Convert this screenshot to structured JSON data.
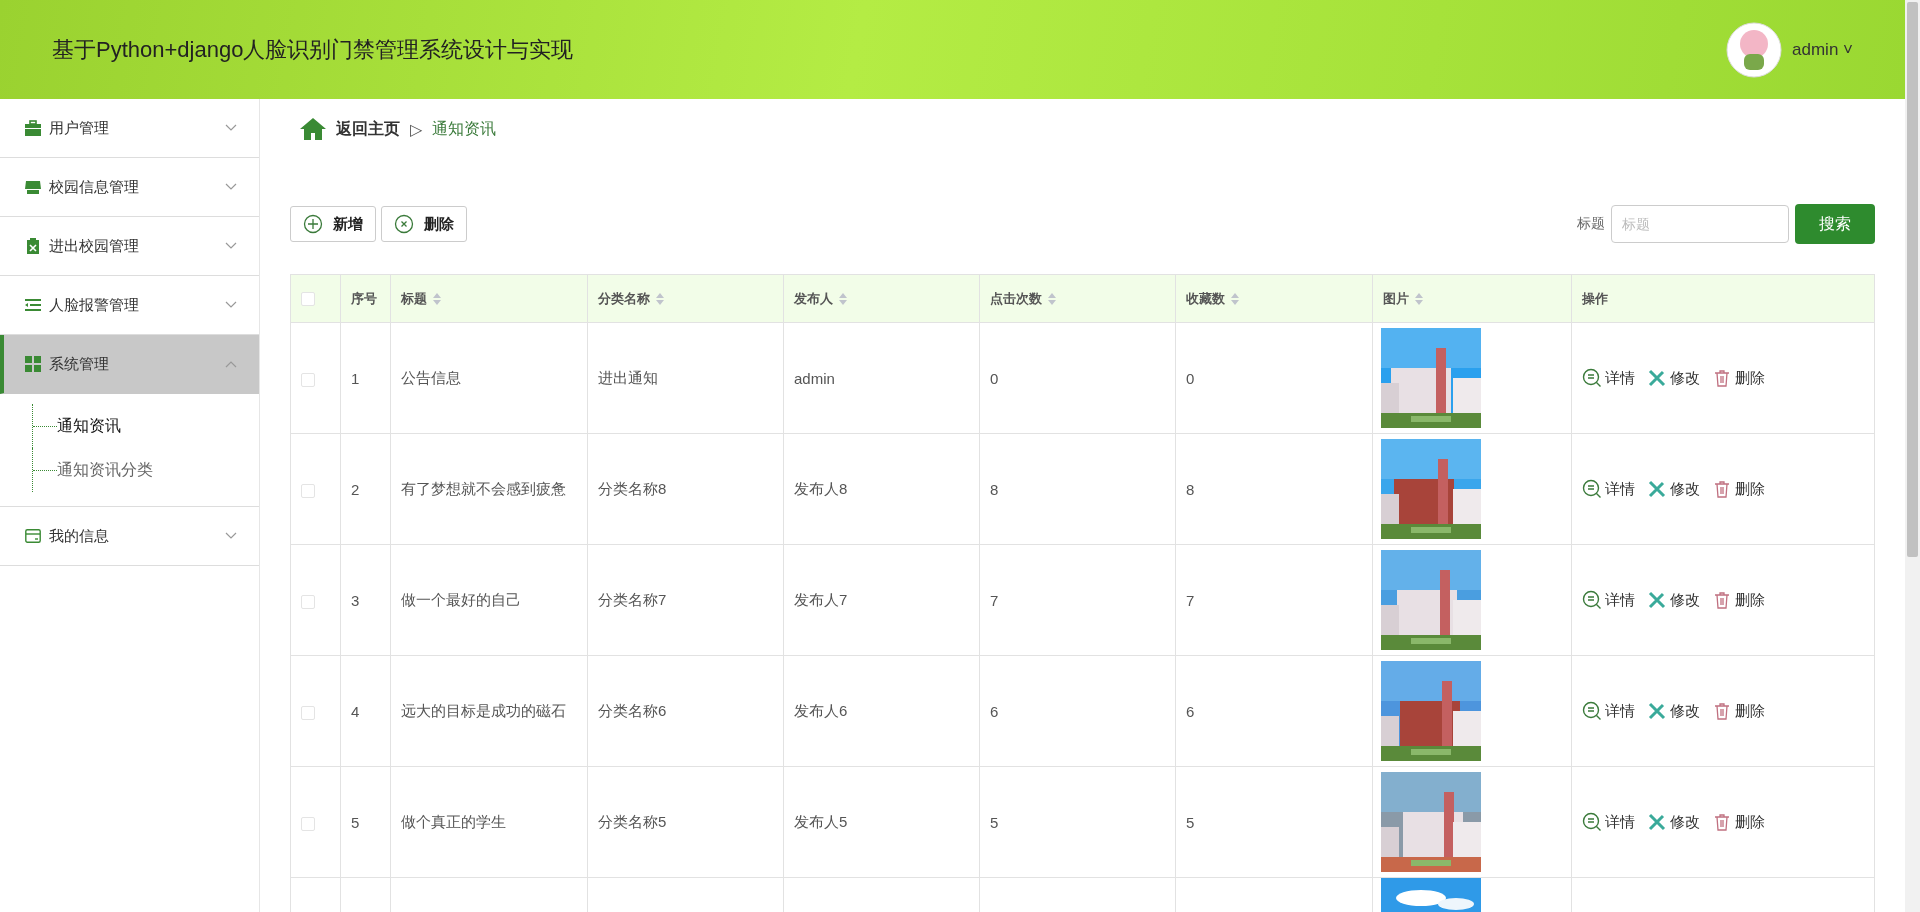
{
  "header": {
    "title": "基于Python+django人脸识别门禁管理系统设计与实现",
    "user": "admin",
    "caret": "˅"
  },
  "sidebar": {
    "items": [
      {
        "label": "用户管理",
        "expanded": false,
        "selected": false
      },
      {
        "label": "校园信息管理",
        "expanded": false,
        "selected": false
      },
      {
        "label": "进出校园管理",
        "expanded": false,
        "selected": false
      },
      {
        "label": "人脸报警管理",
        "expanded": false,
        "selected": false
      },
      {
        "label": "系统管理",
        "expanded": true,
        "selected": true,
        "children": [
          {
            "label": "通知资讯",
            "selected": true
          },
          {
            "label": "通知资讯分类",
            "selected": false
          }
        ]
      },
      {
        "label": "我的信息",
        "expanded": false,
        "selected": false
      }
    ]
  },
  "breadcrumb": {
    "home": "返回主页",
    "separator": "▷",
    "current": "通知资讯"
  },
  "toolbar": {
    "buttons": [
      {
        "label": "新增",
        "kind": "add"
      },
      {
        "label": "删除",
        "kind": "delete"
      }
    ],
    "search": {
      "label": "标题",
      "placeholder": "标题",
      "button": "搜索"
    }
  },
  "table": {
    "header_checked": false,
    "columns": [
      {
        "label": "序号",
        "sortable": false
      },
      {
        "label": "标题",
        "sortable": true
      },
      {
        "label": "分类名称",
        "sortable": true
      },
      {
        "label": "发布人",
        "sortable": true
      },
      {
        "label": "点击次数",
        "sortable": true
      },
      {
        "label": "收藏数",
        "sortable": true
      },
      {
        "label": "图片",
        "sortable": true
      },
      {
        "label": "操作",
        "sortable": false
      }
    ],
    "rows": [
      {
        "checked": false,
        "cells": [
          "1",
          "公告信息",
          "进出通知",
          "admin",
          "0",
          "0"
        ],
        "actions": [
          "详情",
          "修改",
          "删除"
        ]
      },
      {
        "checked": false,
        "cells": [
          "2",
          "有了梦想就不会感到疲惫",
          "分类名称8",
          "发布人8",
          "8",
          "8"
        ],
        "actions": [
          "详情",
          "修改",
          "删除"
        ]
      },
      {
        "checked": false,
        "cells": [
          "3",
          "做一个最好的自己",
          "分类名称7",
          "发布人7",
          "7",
          "7"
        ],
        "actions": [
          "详情",
          "修改",
          "删除"
        ]
      },
      {
        "checked": false,
        "cells": [
          "4",
          "远大的目标是成功的磁石",
          "分类名称6",
          "发布人6",
          "6",
          "6"
        ],
        "actions": [
          "详情",
          "修改",
          "删除"
        ]
      },
      {
        "checked": false,
        "cells": [
          "5",
          "做个真正的学生",
          "分类名称5",
          "发布人5",
          "5",
          "5"
        ],
        "actions": [
          "详情",
          "修改",
          "删除"
        ]
      }
    ]
  }
}
